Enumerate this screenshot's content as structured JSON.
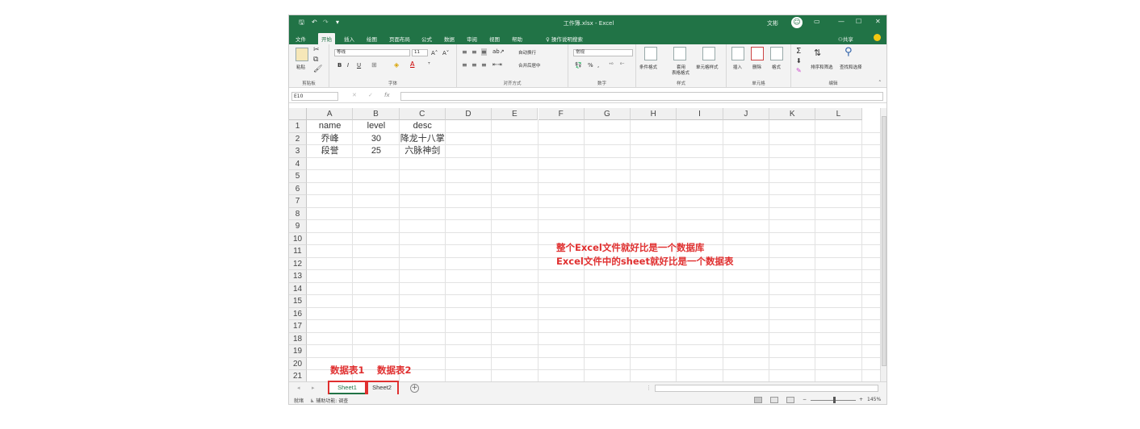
{
  "window": {
    "title": "工作簿.xlsx  -  Excel",
    "user": "文彬",
    "controls": [
      "—",
      "☐",
      "✕"
    ]
  },
  "quick_access": [
    "🖫",
    "↶",
    "↷",
    "▾"
  ],
  "tabs": [
    "文件",
    "开始",
    "插入",
    "绘图",
    "页面布局",
    "公式",
    "数据",
    "审阅",
    "视图",
    "帮助"
  ],
  "active_tab": "开始",
  "tell_me": "操作说明搜索",
  "share": "共享",
  "ribbon": {
    "clipboard": {
      "paste": "粘贴",
      "label": "剪贴板"
    },
    "font": {
      "name": "等线",
      "size": "11",
      "label": "字体",
      "bold": "B",
      "italic": "I",
      "underline": "U"
    },
    "alignment": {
      "wrap": "自动换行",
      "merge": "合并后居中",
      "label": "对齐方式"
    },
    "number": {
      "format": "常规",
      "percent": "%",
      "comma": ",",
      "label": "数字"
    },
    "styles": {
      "conditional": "条件格式",
      "table": "套用",
      "table2": "表格格式",
      "cell_styles": "单元格样式",
      "label": "样式"
    },
    "cells": {
      "insert": "插入",
      "delete": "删除",
      "format": "格式",
      "label": "单元格"
    },
    "editing": {
      "sort": "排序和筛选",
      "find": "查找和选择",
      "label": "编辑",
      "sigma": "Σ"
    }
  },
  "formula_bar": {
    "name_box": "E10",
    "fx": "fx",
    "value": ""
  },
  "columns": [
    "A",
    "B",
    "C",
    "D",
    "E",
    "F",
    "G",
    "H",
    "I",
    "J",
    "K",
    "L"
  ],
  "rows": [
    "1",
    "2",
    "3",
    "4",
    "5",
    "6",
    "7",
    "8",
    "9",
    "10",
    "11",
    "12",
    "13",
    "14",
    "15",
    "16",
    "17",
    "18",
    "19",
    "20",
    "21"
  ],
  "cells": [
    [
      "name",
      "level",
      "desc"
    ],
    [
      "乔峰",
      "30",
      "降龙十八掌"
    ],
    [
      "段誉",
      "25",
      "六脉神剑"
    ]
  ],
  "annotations": {
    "line1": "整个Excel文件就好比是一个数据库",
    "line2": "Excel文件中的sheet就好比是一个数据表",
    "tab1_label": "数据表1",
    "tab2_label": "数据表2"
  },
  "sheets": [
    "Sheet1",
    "Sheet2"
  ],
  "active_sheet": "Sheet1",
  "status": {
    "ready": "就绪",
    "accessibility": "辅助功能: 调查",
    "zoom": "145%"
  },
  "colors": {
    "brand": "#217346",
    "annotation": "#e03030"
  }
}
